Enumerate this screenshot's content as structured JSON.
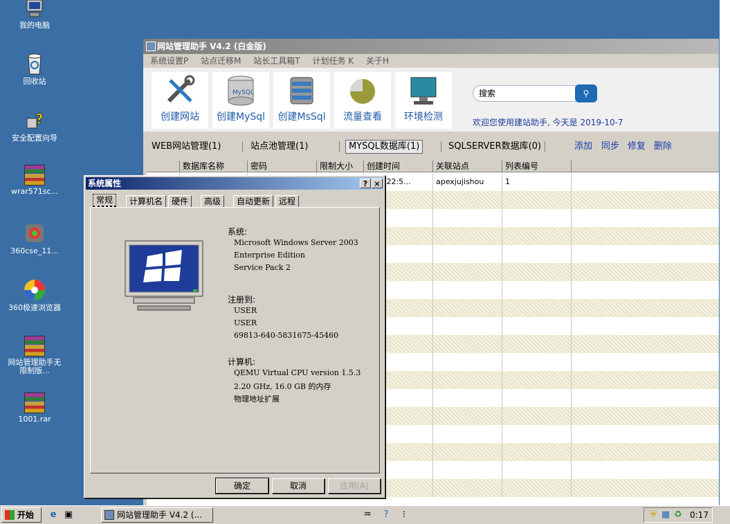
{
  "desktop": {
    "icons": [
      {
        "label": "我的电脑",
        "icon": "my-computer-icon"
      },
      {
        "label": "回收站",
        "icon": "recycle-bin-icon"
      },
      {
        "label": "安全配置向导",
        "icon": "security-wizard-icon"
      },
      {
        "label": "wrar571sc...",
        "icon": "winrar-archive-icon"
      },
      {
        "label": "360cse_11...",
        "icon": "360-installer-icon"
      },
      {
        "label": "360极速浏览器",
        "icon": "360-browser-icon"
      },
      {
        "label": "网站管理助手无限制版...",
        "icon": "winrar-archive-icon"
      },
      {
        "label": "1001.rar",
        "icon": "winrar-archive-icon"
      }
    ]
  },
  "app": {
    "title": "网站管理助手 V4.2 (白金版)",
    "menu": [
      "系统设置P",
      "站点迁移M",
      "站长工具箱T",
      "计划任务 K",
      "关于H"
    ],
    "toolbar": [
      {
        "label": "创建网站",
        "icon": "wrench-screwdriver-icon"
      },
      {
        "label": "创建MySql",
        "icon": "mysql-database-icon"
      },
      {
        "label": "创建MsSql",
        "icon": "mssql-database-icon"
      },
      {
        "label": "流量查看",
        "icon": "traffic-pie-icon"
      },
      {
        "label": "环境检测",
        "icon": "monitor-check-icon"
      }
    ],
    "search_placeholder": "搜索",
    "welcome": "欢迎您使用建站助手, 今天是 2019-10-7",
    "tabs": [
      "WEB网站管理(1)",
      "站点池管理(1)",
      "MYSQL数据库(1)",
      "SQLSERVER数据库(0)"
    ],
    "actions": [
      "添加",
      "同步",
      "修复",
      "删除"
    ],
    "grid": {
      "headers": [
        "数据库名称",
        "密码",
        "限制大小",
        "创建时间",
        "关联站点",
        "列表编号"
      ],
      "rows": [
        [
          "",
          "",
          "",
          "10-6 22:5...",
          "apexjujishou",
          "1"
        ]
      ]
    }
  },
  "dialog": {
    "title": "系统属性",
    "help": "?",
    "close": "×",
    "tabs": [
      "常规",
      "计算机名",
      "硬件",
      "高级",
      "自动更新",
      "远程"
    ],
    "system_header": "系统:",
    "system_lines": [
      "Microsoft Windows Server 2003",
      "Enterprise Edition",
      "Service Pack 2"
    ],
    "registered_header": "注册到:",
    "registered_lines": [
      "USER",
      "USER",
      "69813-640-5831675-45460"
    ],
    "computer_header": "计算机:",
    "computer_lines": [
      "QEMU Virtual CPU version 1.5.3",
      "2.20 GHz, 16.0 GB 的内存",
      "物理地址扩展"
    ],
    "buttons": {
      "ok": "确定",
      "cancel": "取消",
      "apply": "应用(A)"
    }
  },
  "taskbar": {
    "start": "开始",
    "task": "网站管理助手 V4.2 (...",
    "clock": "0:17"
  }
}
